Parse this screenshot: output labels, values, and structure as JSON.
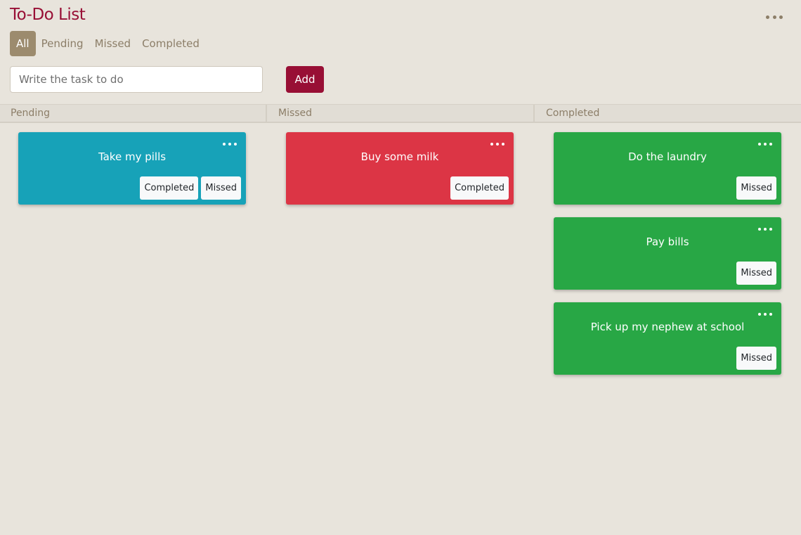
{
  "app": {
    "title": "To-Do List"
  },
  "filters": [
    {
      "label": "All",
      "active": true
    },
    {
      "label": "Pending",
      "active": false
    },
    {
      "label": "Missed",
      "active": false
    },
    {
      "label": "Completed",
      "active": false
    }
  ],
  "form": {
    "placeholder": "Write the task to do",
    "value": "",
    "add_label": "Add"
  },
  "columns": {
    "pending": {
      "header": "Pending",
      "color": "#17a2b8",
      "cards": [
        {
          "text": "Take my pills",
          "actions": [
            "Completed",
            "Missed"
          ]
        }
      ]
    },
    "missed": {
      "header": "Missed",
      "color": "#dc3545",
      "cards": [
        {
          "text": "Buy some milk",
          "actions": [
            "Completed"
          ]
        }
      ]
    },
    "completed": {
      "header": "Completed",
      "color": "#28a745",
      "cards": [
        {
          "text": "Do the laundry",
          "actions": [
            "Missed"
          ]
        },
        {
          "text": "Pay bills",
          "actions": [
            "Missed"
          ]
        },
        {
          "text": "Pick up my nephew at school",
          "actions": [
            "Missed"
          ]
        }
      ]
    }
  },
  "icons": {
    "menu": "more-horizontal-icon"
  },
  "colors": {
    "accent": "#980f35",
    "active_filter": "#9c8b6e",
    "background": "#e8e4dc"
  }
}
